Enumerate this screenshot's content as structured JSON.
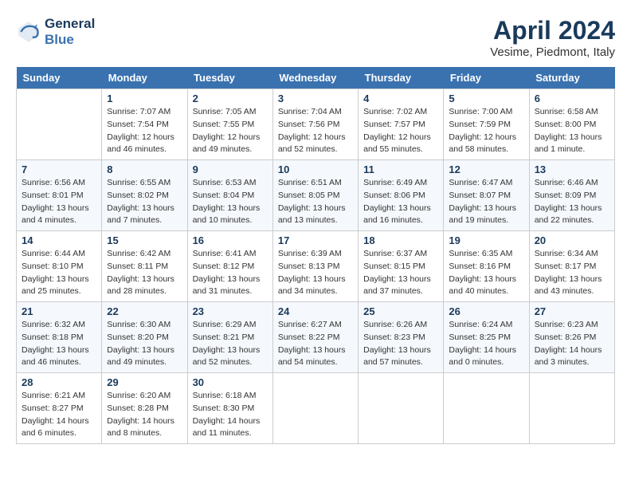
{
  "header": {
    "logo_line1": "General",
    "logo_line2": "Blue",
    "month": "April 2024",
    "location": "Vesime, Piedmont, Italy"
  },
  "days_of_week": [
    "Sunday",
    "Monday",
    "Tuesday",
    "Wednesday",
    "Thursday",
    "Friday",
    "Saturday"
  ],
  "weeks": [
    [
      {
        "day": "",
        "sunrise": "",
        "sunset": "",
        "daylight": ""
      },
      {
        "day": "1",
        "sunrise": "Sunrise: 7:07 AM",
        "sunset": "Sunset: 7:54 PM",
        "daylight": "Daylight: 12 hours and 46 minutes."
      },
      {
        "day": "2",
        "sunrise": "Sunrise: 7:05 AM",
        "sunset": "Sunset: 7:55 PM",
        "daylight": "Daylight: 12 hours and 49 minutes."
      },
      {
        "day": "3",
        "sunrise": "Sunrise: 7:04 AM",
        "sunset": "Sunset: 7:56 PM",
        "daylight": "Daylight: 12 hours and 52 minutes."
      },
      {
        "day": "4",
        "sunrise": "Sunrise: 7:02 AM",
        "sunset": "Sunset: 7:57 PM",
        "daylight": "Daylight: 12 hours and 55 minutes."
      },
      {
        "day": "5",
        "sunrise": "Sunrise: 7:00 AM",
        "sunset": "Sunset: 7:59 PM",
        "daylight": "Daylight: 12 hours and 58 minutes."
      },
      {
        "day": "6",
        "sunrise": "Sunrise: 6:58 AM",
        "sunset": "Sunset: 8:00 PM",
        "daylight": "Daylight: 13 hours and 1 minute."
      }
    ],
    [
      {
        "day": "7",
        "sunrise": "Sunrise: 6:56 AM",
        "sunset": "Sunset: 8:01 PM",
        "daylight": "Daylight: 13 hours and 4 minutes."
      },
      {
        "day": "8",
        "sunrise": "Sunrise: 6:55 AM",
        "sunset": "Sunset: 8:02 PM",
        "daylight": "Daylight: 13 hours and 7 minutes."
      },
      {
        "day": "9",
        "sunrise": "Sunrise: 6:53 AM",
        "sunset": "Sunset: 8:04 PM",
        "daylight": "Daylight: 13 hours and 10 minutes."
      },
      {
        "day": "10",
        "sunrise": "Sunrise: 6:51 AM",
        "sunset": "Sunset: 8:05 PM",
        "daylight": "Daylight: 13 hours and 13 minutes."
      },
      {
        "day": "11",
        "sunrise": "Sunrise: 6:49 AM",
        "sunset": "Sunset: 8:06 PM",
        "daylight": "Daylight: 13 hours and 16 minutes."
      },
      {
        "day": "12",
        "sunrise": "Sunrise: 6:47 AM",
        "sunset": "Sunset: 8:07 PM",
        "daylight": "Daylight: 13 hours and 19 minutes."
      },
      {
        "day": "13",
        "sunrise": "Sunrise: 6:46 AM",
        "sunset": "Sunset: 8:09 PM",
        "daylight": "Daylight: 13 hours and 22 minutes."
      }
    ],
    [
      {
        "day": "14",
        "sunrise": "Sunrise: 6:44 AM",
        "sunset": "Sunset: 8:10 PM",
        "daylight": "Daylight: 13 hours and 25 minutes."
      },
      {
        "day": "15",
        "sunrise": "Sunrise: 6:42 AM",
        "sunset": "Sunset: 8:11 PM",
        "daylight": "Daylight: 13 hours and 28 minutes."
      },
      {
        "day": "16",
        "sunrise": "Sunrise: 6:41 AM",
        "sunset": "Sunset: 8:12 PM",
        "daylight": "Daylight: 13 hours and 31 minutes."
      },
      {
        "day": "17",
        "sunrise": "Sunrise: 6:39 AM",
        "sunset": "Sunset: 8:13 PM",
        "daylight": "Daylight: 13 hours and 34 minutes."
      },
      {
        "day": "18",
        "sunrise": "Sunrise: 6:37 AM",
        "sunset": "Sunset: 8:15 PM",
        "daylight": "Daylight: 13 hours and 37 minutes."
      },
      {
        "day": "19",
        "sunrise": "Sunrise: 6:35 AM",
        "sunset": "Sunset: 8:16 PM",
        "daylight": "Daylight: 13 hours and 40 minutes."
      },
      {
        "day": "20",
        "sunrise": "Sunrise: 6:34 AM",
        "sunset": "Sunset: 8:17 PM",
        "daylight": "Daylight: 13 hours and 43 minutes."
      }
    ],
    [
      {
        "day": "21",
        "sunrise": "Sunrise: 6:32 AM",
        "sunset": "Sunset: 8:18 PM",
        "daylight": "Daylight: 13 hours and 46 minutes."
      },
      {
        "day": "22",
        "sunrise": "Sunrise: 6:30 AM",
        "sunset": "Sunset: 8:20 PM",
        "daylight": "Daylight: 13 hours and 49 minutes."
      },
      {
        "day": "23",
        "sunrise": "Sunrise: 6:29 AM",
        "sunset": "Sunset: 8:21 PM",
        "daylight": "Daylight: 13 hours and 52 minutes."
      },
      {
        "day": "24",
        "sunrise": "Sunrise: 6:27 AM",
        "sunset": "Sunset: 8:22 PM",
        "daylight": "Daylight: 13 hours and 54 minutes."
      },
      {
        "day": "25",
        "sunrise": "Sunrise: 6:26 AM",
        "sunset": "Sunset: 8:23 PM",
        "daylight": "Daylight: 13 hours and 57 minutes."
      },
      {
        "day": "26",
        "sunrise": "Sunrise: 6:24 AM",
        "sunset": "Sunset: 8:25 PM",
        "daylight": "Daylight: 14 hours and 0 minutes."
      },
      {
        "day": "27",
        "sunrise": "Sunrise: 6:23 AM",
        "sunset": "Sunset: 8:26 PM",
        "daylight": "Daylight: 14 hours and 3 minutes."
      }
    ],
    [
      {
        "day": "28",
        "sunrise": "Sunrise: 6:21 AM",
        "sunset": "Sunset: 8:27 PM",
        "daylight": "Daylight: 14 hours and 6 minutes."
      },
      {
        "day": "29",
        "sunrise": "Sunrise: 6:20 AM",
        "sunset": "Sunset: 8:28 PM",
        "daylight": "Daylight: 14 hours and 8 minutes."
      },
      {
        "day": "30",
        "sunrise": "Sunrise: 6:18 AM",
        "sunset": "Sunset: 8:30 PM",
        "daylight": "Daylight: 14 hours and 11 minutes."
      },
      {
        "day": "",
        "sunrise": "",
        "sunset": "",
        "daylight": ""
      },
      {
        "day": "",
        "sunrise": "",
        "sunset": "",
        "daylight": ""
      },
      {
        "day": "",
        "sunrise": "",
        "sunset": "",
        "daylight": ""
      },
      {
        "day": "",
        "sunrise": "",
        "sunset": "",
        "daylight": ""
      }
    ]
  ]
}
